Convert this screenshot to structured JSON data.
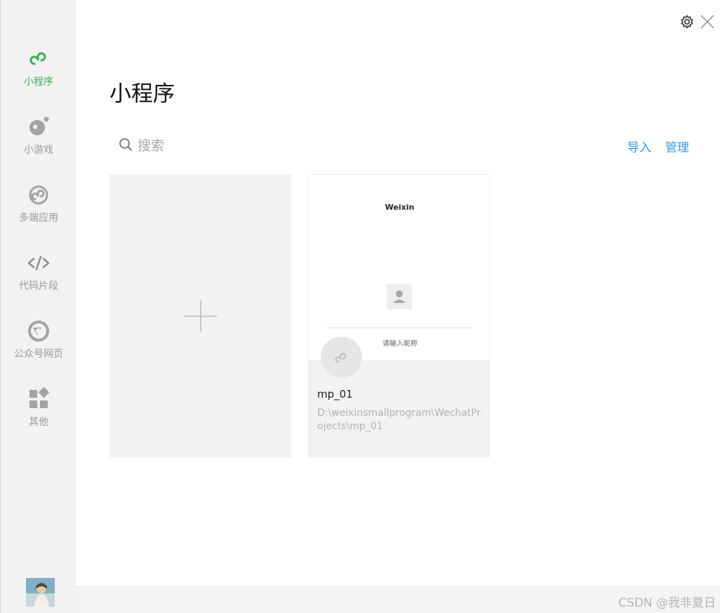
{
  "sidebar": {
    "items": [
      {
        "label": "小程序",
        "icon": "miniprogram-link-icon",
        "active": true
      },
      {
        "label": "小游戏",
        "icon": "game-icon",
        "active": false
      },
      {
        "label": "多端应用",
        "icon": "multi-platform-icon",
        "active": false
      },
      {
        "label": "代码片段",
        "icon": "code-icon",
        "active": false
      },
      {
        "label": "公众号网页",
        "icon": "official-account-icon",
        "active": false
      },
      {
        "label": "其他",
        "icon": "other-grid-icon",
        "active": false
      }
    ],
    "avatar_icon": "user-avatar"
  },
  "header": {
    "title": "小程序",
    "settings_icon": "gear-icon",
    "close_icon": "close-icon"
  },
  "search": {
    "placeholder": "搜索",
    "icon": "search-icon"
  },
  "actions": {
    "import_label": "导入",
    "manage_label": "管理"
  },
  "projects": [
    {
      "preview_title": "Weixin",
      "preview_hint": "请输入昵称",
      "name": "mp_01",
      "path": "D:\\weixinsmallprogram\\WechatProjects\\mp_01"
    }
  ],
  "footer": {
    "watermark": "CSDN @我非夏日"
  },
  "colors": {
    "accent_green": "#3cad56",
    "link_blue": "#2f9ae5",
    "sidebar_bg": "#f2f2f2"
  }
}
